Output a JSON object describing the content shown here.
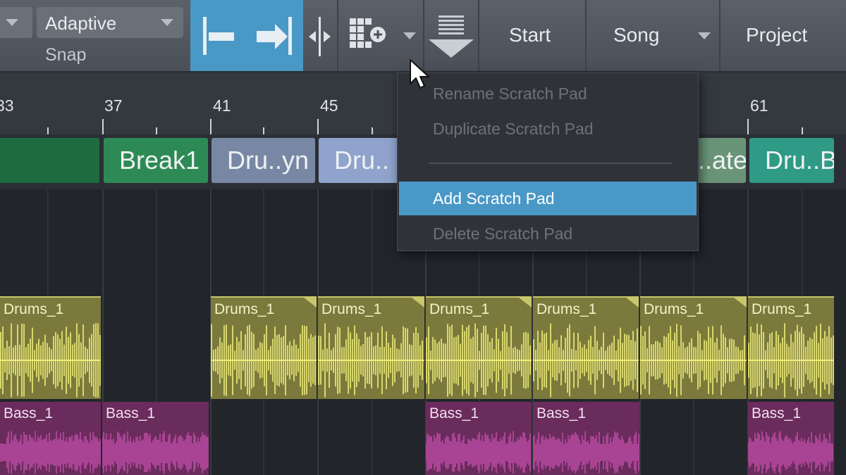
{
  "toolbar": {
    "quantize_value": "Adaptive",
    "snap_label": "Snap",
    "start_label": "Start",
    "song_label": "Song",
    "project_label": "Project"
  },
  "ruler": {
    "bars": [
      "33",
      "37",
      "41",
      "45",
      "61"
    ]
  },
  "arranger": {
    "sections": [
      {
        "label": "",
        "color": "#1d6b3f"
      },
      {
        "label": "Break1",
        "color": "#2e8a55"
      },
      {
        "label": "Dru..yn",
        "color": "#7888a4"
      },
      {
        "label": "Dru..",
        "color": "#8fa3cc"
      },
      {
        "label": "..ate",
        "color": "#6a9478"
      },
      {
        "label": "Dru..B",
        "color": "#2f9a86"
      }
    ]
  },
  "tracks": {
    "drums": [
      {
        "label": "Drums_1"
      },
      {
        "label": "Drums_1"
      },
      {
        "label": "Drums_1"
      },
      {
        "label": "Drums_1"
      },
      {
        "label": "Drums_1"
      },
      {
        "label": "Drums_1"
      },
      {
        "label": "Drums_1"
      }
    ],
    "bass": [
      {
        "label": "Bass_1"
      },
      {
        "label": "Bass_1"
      },
      {
        "label": "Bass_1"
      },
      {
        "label": "Bass_1"
      },
      {
        "label": "Bass_1"
      }
    ]
  },
  "context_menu": {
    "items": [
      {
        "label": "Rename Scratch Pad",
        "enabled": false
      },
      {
        "label": "Duplicate Scratch Pad",
        "enabled": false
      },
      {
        "label": "Add Scratch Pad",
        "enabled": true,
        "highlighted": true
      },
      {
        "label": "Delete Scratch Pad",
        "enabled": false
      }
    ]
  },
  "colors": {
    "accent": "#4a98c6",
    "drum_clip": "#7b7a3c",
    "drum_wave": "#f0ee7a",
    "bass_clip": "#6a2c5c",
    "bass_wave": "#c24fab"
  },
  "icons": [
    "chevron-down-icon",
    "timestretch-left-icon",
    "timestretch-right-icon",
    "split-icon",
    "scratch-pad-icon",
    "drop-down-icon",
    "mouse-cursor-icon"
  ]
}
